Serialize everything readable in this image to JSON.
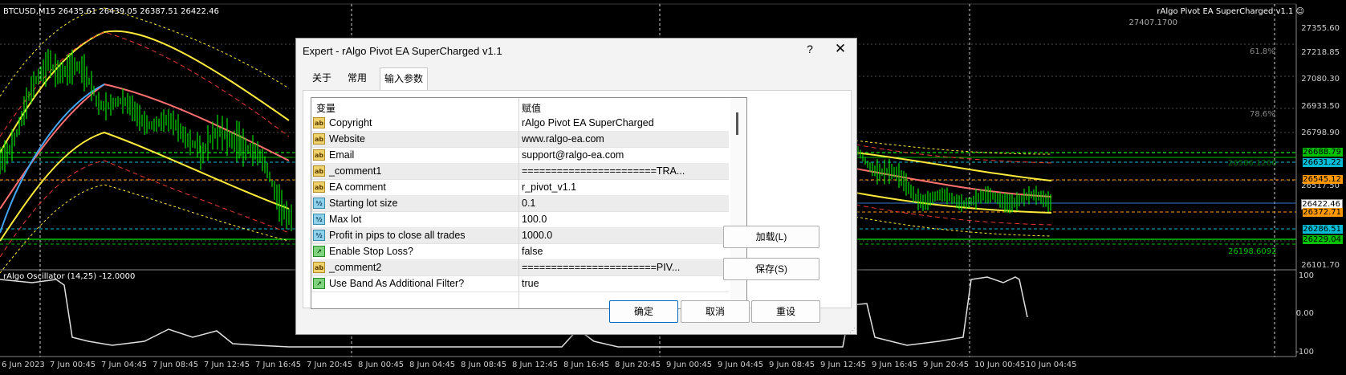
{
  "chart": {
    "symbol_info": "BTCUSD,M15  26435.61 26439.05 26387.51 26422.46",
    "ea_label": "rAlgo Pivot EA SuperCharged v1.1 ☺",
    "osc_info": "rAlgo Oscillator (14,25) -12.0000",
    "axis_prices": [
      "27407.1700",
      "27355.60",
      "27218.85",
      "27080.30",
      "26933.50",
      "26798.90",
      "26517.50",
      "26101.70",
      "100",
      "0.00",
      "-100"
    ],
    "fib_labels": [
      "61.8%",
      "78.6%",
      "26198.6092",
      "26586.1266"
    ],
    "price_tags": [
      {
        "text": "26688.79",
        "color": "#00c000"
      },
      {
        "text": "26631.22",
        "color": "#00bcd4"
      },
      {
        "text": "26545.12",
        "color": "#ff9800"
      },
      {
        "text": "26422.46",
        "color": "#c0c0c0"
      },
      {
        "text": "26372.71",
        "color": "#ff9800"
      },
      {
        "text": "26286.51",
        "color": "#00bcd4"
      },
      {
        "text": "26229.04",
        "color": "#00c000"
      }
    ],
    "time_labels": [
      "6 Jun 2023",
      "7 Jun 00:45",
      "7 Jun 04:45",
      "7 Jun 08:45",
      "7 Jun 12:45",
      "7 Jun 16:45",
      "7 Jun 20:45",
      "8 Jun 00:45",
      "8 Jun 04:45",
      "8 Jun 08:45",
      "8 Jun 12:45",
      "8 Jun 16:45",
      "8 Jun 20:45",
      "9 Jun 00:45",
      "9 Jun 04:45",
      "9 Jun 08:45",
      "9 Jun 12:45",
      "9 Jun 16:45",
      "9 Jun 20:45",
      "10 Jun 00:45",
      "10 Jun 04:45"
    ]
  },
  "dialog": {
    "title": "Expert - rAlgo Pivot EA SuperCharged v1.1",
    "help": "?",
    "close": "✕",
    "tabs": [
      "关于",
      "常用",
      "输入参数"
    ],
    "columns": {
      "variable": "变量",
      "value": "赋值"
    },
    "rows": [
      {
        "type": "ab",
        "name": "Copyright",
        "value": "rAlgo Pivot EA SuperCharged"
      },
      {
        "type": "ab",
        "name": "Website",
        "value": "www.ralgo-ea.com"
      },
      {
        "type": "ab",
        "name": "Email",
        "value": "support@ralgo-ea.com"
      },
      {
        "type": "ab",
        "name": "_comment1",
        "value": "=======================TRA..."
      },
      {
        "type": "ab",
        "name": "EA comment",
        "value": "r_pivot_v1.1"
      },
      {
        "type": "num",
        "name": "Starting lot size",
        "value": "0.1"
      },
      {
        "type": "num",
        "name": "Max lot",
        "value": "100.0"
      },
      {
        "type": "num",
        "name": "Profit in pips to close all trades",
        "value": "1000.0"
      },
      {
        "type": "bool",
        "name": "Enable Stop Loss?",
        "value": "false"
      },
      {
        "type": "ab",
        "name": "_comment2",
        "value": "=======================PIV..."
      },
      {
        "type": "bool",
        "name": "Use Band As Additional Filter?",
        "value": "true"
      }
    ],
    "side_buttons": {
      "load": "加载(L)",
      "save": "保存(S)"
    },
    "buttons": {
      "ok": "确定",
      "cancel": "取消",
      "reset": "重设"
    }
  }
}
